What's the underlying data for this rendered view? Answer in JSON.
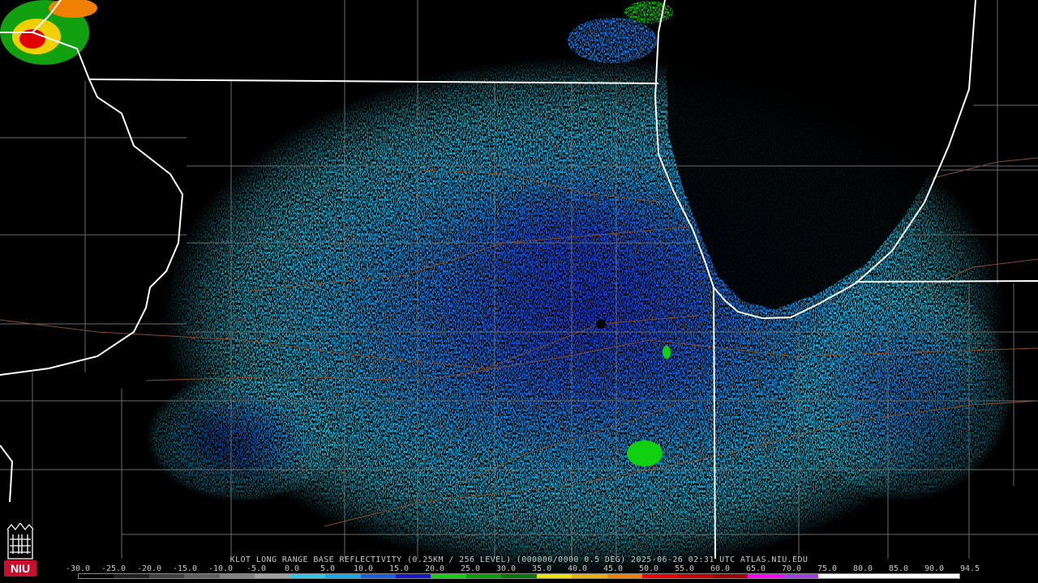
{
  "caption": "KLOT LONG RANGE BASE REFLECTIVITY (0.25KM / 256 LEVEL) (000000/0000 0.5 DEG) 2025-06-26 02:31 UTC  ATLAS.NIU.EDU",
  "scale": {
    "ticks": [
      "-30.0",
      "-25.0",
      "-20.0",
      "-15.0",
      "-10.0",
      "-5.0",
      "0.0",
      "5.0",
      "10.0",
      "15.0",
      "20.0",
      "25.0",
      "30.0",
      "35.0",
      "40.0",
      "45.0",
      "50.0",
      "55.0",
      "60.0",
      "65.0",
      "70.0",
      "75.0",
      "80.0",
      "85.0",
      "90.0",
      "94.5"
    ],
    "colors": [
      "#000000",
      "#202020",
      "#404040",
      "#606060",
      "#808080",
      "#a0a0a0",
      "#2ec8e6",
      "#16a8e8",
      "#1a60e0",
      "#1818c8",
      "#10d010",
      "#08a008",
      "#067806",
      "#f0e000",
      "#e8b000",
      "#f08000",
      "#f00000",
      "#c80000",
      "#a00000",
      "#ff00ff",
      "#a040e0",
      "#ffffff",
      "#ffffff",
      "#ffffff",
      "#ffffff"
    ]
  },
  "logo": {
    "text": "NIU",
    "color": "#c8102e"
  },
  "map": {
    "background": "#000000",
    "state_line_color": "#ffffff",
    "county_line_color": "#6a6a6a",
    "road_color": "#8a4a2a",
    "radar_site_color": "#000000"
  }
}
